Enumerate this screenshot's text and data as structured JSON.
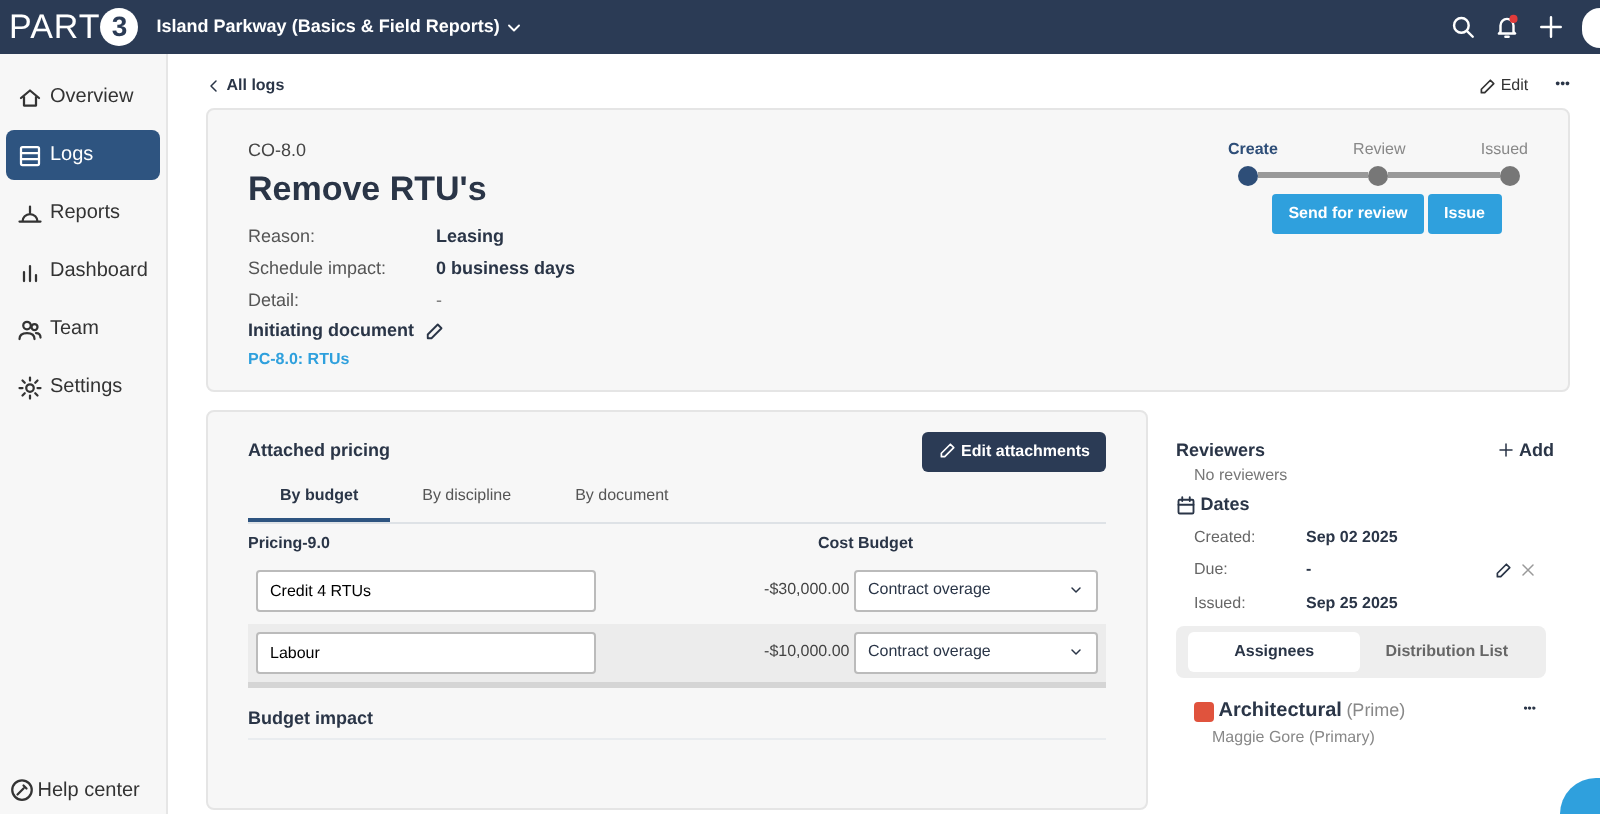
{
  "topbar": {
    "logo": "PART",
    "logo_mark": "3",
    "project": "Island Parkway (Basics & Field Reports)",
    "notification_unread": true
  },
  "sidebar": {
    "items": [
      {
        "label": "Overview",
        "selected": false
      },
      {
        "label": "Logs",
        "selected": true
      },
      {
        "label": "Reports",
        "selected": false
      },
      {
        "label": "Dashboard",
        "selected": false
      },
      {
        "label": "Team",
        "selected": false
      },
      {
        "label": "Settings",
        "selected": false
      }
    ],
    "footer": "Help center"
  },
  "back_link": "All logs",
  "edit_label": "Edit",
  "more_label": "•••",
  "header": {
    "code": "CO-8.0",
    "title": "Remove RTU's",
    "fields": [
      {
        "label": "Reason:",
        "value": "Leasing"
      },
      {
        "label": "Schedule impact:",
        "value": "0 business days"
      },
      {
        "label": "Detail:",
        "value": "-"
      }
    ],
    "initiating_label": "Initiating document",
    "initiating_link": "PC-8.0: RTUs",
    "steps": [
      {
        "label": "Create",
        "selected": true
      },
      {
        "label": "Review",
        "selected": false
      },
      {
        "label": "Issued",
        "selected": false
      }
    ],
    "buttons": [
      "Send for review",
      "Issue"
    ]
  },
  "pricing": {
    "title": "Attached pricing",
    "edit_button": "Edit attachments",
    "tabs": [
      {
        "label": "By budget",
        "selected": true
      },
      {
        "label": "By discipline",
        "selected": false
      },
      {
        "label": "By document",
        "selected": false
      }
    ],
    "columns": [
      "Pricing-9.0",
      "Cost",
      "Budget"
    ],
    "rows": [
      {
        "name": "Credit 4 RTUs",
        "cost": "-$30,000.00",
        "budget": "Contract overage",
        "selected": false
      },
      {
        "name": "Labour",
        "cost": "-$10,000.00",
        "budget": "Contract overage",
        "selected": true
      }
    ],
    "budget_impact": "Budget impact"
  },
  "reviewers": {
    "title": "Reviewers",
    "add": "Add",
    "empty": "No reviewers"
  },
  "dates": {
    "title": "Dates",
    "rows": [
      {
        "label": "Created:",
        "value": "Sep 02 2025",
        "editable": false
      },
      {
        "label": "Due:",
        "value": "-",
        "editable": true
      },
      {
        "label": "Issued:",
        "value": "Sep 25 2025",
        "editable": false
      }
    ]
  },
  "assign_tabs": [
    {
      "label": "Assignees",
      "selected": true
    },
    {
      "label": "Distribution List",
      "selected": false
    }
  ],
  "assignees": [
    {
      "name": "Architectural",
      "role": "(Prime)",
      "more": "•••",
      "color": "#e0533d",
      "person": "Maggie Gore",
      "person_role": "(Primary)"
    }
  ]
}
